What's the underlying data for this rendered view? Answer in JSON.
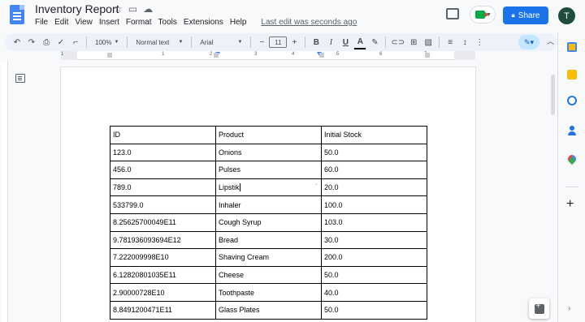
{
  "document": {
    "title": "Inventory Report",
    "last_edit": "Last edit was seconds ago"
  },
  "menu": [
    "File",
    "Edit",
    "View",
    "Insert",
    "Format",
    "Tools",
    "Extensions",
    "Help"
  ],
  "header": {
    "share_label": "Share",
    "avatar_initial": "T",
    "share_color": "#1a73e8"
  },
  "toolbar": {
    "zoom": "100%",
    "style": "Normal text",
    "font": "Arial",
    "font_size": "11",
    "bold": "B",
    "italic": "I",
    "underline": "U",
    "text_color": "A"
  },
  "ruler": {
    "numbers": [
      "1",
      "1",
      "2",
      "3",
      "4",
      "5",
      "6",
      "7"
    ]
  },
  "table": {
    "rows": [
      [
        "ID",
        "Product",
        "Initial Stock"
      ],
      [
        "123.0",
        "Onions",
        "50.0"
      ],
      [
        "456.0",
        "Pulses",
        "60.0"
      ],
      [
        "789.0",
        "Lipstik",
        "20.0"
      ],
      [
        "533799.0",
        "Inhaler",
        "100.0"
      ],
      [
        "8.25625700049E11",
        "Cough Syrup",
        "103.0"
      ],
      [
        "9.781936093694E12",
        "Bread",
        "30.0"
      ],
      [
        "7.222009998E10",
        "Shaving Cream",
        "200.0"
      ],
      [
        "6.12820801035E11",
        "Cheese",
        "50.0"
      ],
      [
        "2.90000728E10",
        "Toothpaste",
        "40.0"
      ],
      [
        "8.8491200471E11",
        "Glass Plates",
        "50.0"
      ]
    ]
  }
}
